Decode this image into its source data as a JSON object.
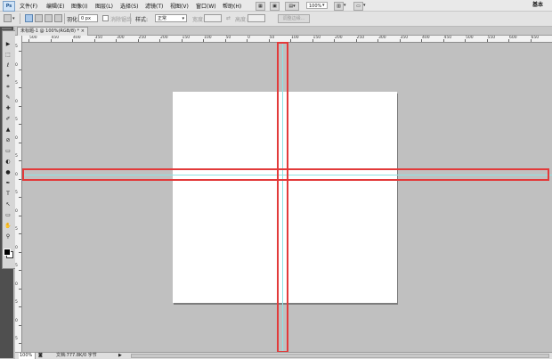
{
  "menubar": {
    "logo": "Ps",
    "items": [
      "文件(F)",
      "编辑(E)",
      "图像(I)",
      "图层(L)",
      "选择(S)",
      "滤镜(T)",
      "视图(V)",
      "窗口(W)",
      "帮助(H)"
    ],
    "zoom": "100%",
    "workspace": "基本"
  },
  "options": {
    "feather_label": "羽化:",
    "feather_value": "0 px",
    "antialias_label": "消除锯齿",
    "style_label": "样式:",
    "style_value": "正常",
    "width_label": "宽度:",
    "height_label": "高度:",
    "refine_button": "调整边缘..."
  },
  "document": {
    "tab_title": "未标题-1 @ 100%(RGB/8) *"
  },
  "ruler": {
    "h_labels": [
      "500",
      "450",
      "400",
      "350",
      "300",
      "250",
      "200",
      "150",
      "100",
      "50",
      "0",
      "50",
      "100",
      "150",
      "200",
      "250",
      "300",
      "350",
      "400",
      "450",
      "500",
      "550",
      "600",
      "650",
      "700",
      "750"
    ],
    "v_labels": [
      "5",
      "0",
      "5",
      "0",
      "5",
      "0",
      "5",
      "0",
      "5",
      "0",
      "5",
      "0",
      "5",
      "0",
      "5",
      "0",
      "5"
    ]
  },
  "tools": [
    "▶",
    "⬚",
    "ℓ",
    "✦",
    "⌗",
    "✎",
    "✚",
    "✐",
    "▲",
    "⊘",
    "▭",
    "◐",
    "●",
    "✒",
    "T",
    "↖",
    "▭",
    "✋",
    "⚲"
  ],
  "status": {
    "zoom": "100%",
    "doc_info": "文档:777.8K/0 字节",
    "arrow": "▶"
  },
  "colors": {
    "highlight": "#e23a3a",
    "guide": "#8fe3e3"
  }
}
